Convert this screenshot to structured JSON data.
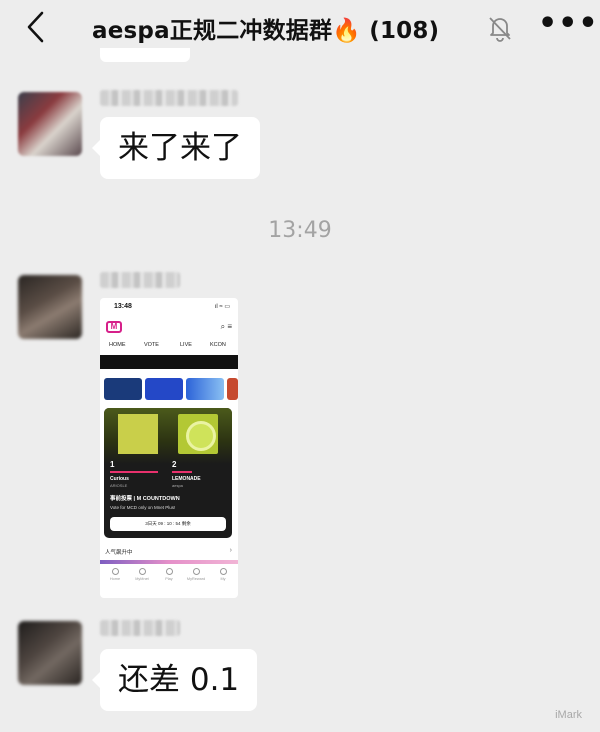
{
  "header": {
    "back_icon": "chevron-left-icon",
    "title": "aespa正规二冲数据群🔥 (108)",
    "mute_icon": "bell-slash-icon",
    "more_icon": "more-dots-icon",
    "more_glyph": "•••"
  },
  "messages": [
    {
      "type": "text",
      "text": "来了来了"
    },
    {
      "type": "timestamp",
      "text": "13:49"
    },
    {
      "type": "image"
    },
    {
      "type": "text",
      "text": "还差 0.1"
    }
  ],
  "shared_screenshot": {
    "status_time": "13:48",
    "status_icons": "ıl ≈ ▭",
    "logo": "M",
    "toolbar_icons": "⌕ ≡",
    "nav": [
      "HOME",
      "VOTE",
      "LIVE",
      "KCON"
    ],
    "rank1": {
      "rank": "1",
      "song": "Curious",
      "artist": "ARIOSLE"
    },
    "rank2": {
      "rank": "2",
      "song": "LEMONADE",
      "artist": "aespa"
    },
    "vote_title": "事前投票 | M COUNTDOWN",
    "vote_subtitle": "Vote for MCD only on Mnet Plus!",
    "vote_button": "3日天 09 : 10 : 54 剩余",
    "section_label": "人气飙升中",
    "section_chevron": "›",
    "tabbar": [
      "Home",
      "MyMnet",
      "Play",
      "MyReward",
      "My"
    ]
  },
  "watermark": "iMark",
  "colors": {
    "background": "#ededed",
    "bubble": "#ffffff",
    "accent_pink": "#d6208a",
    "timestamp": "#a3a3a3"
  }
}
